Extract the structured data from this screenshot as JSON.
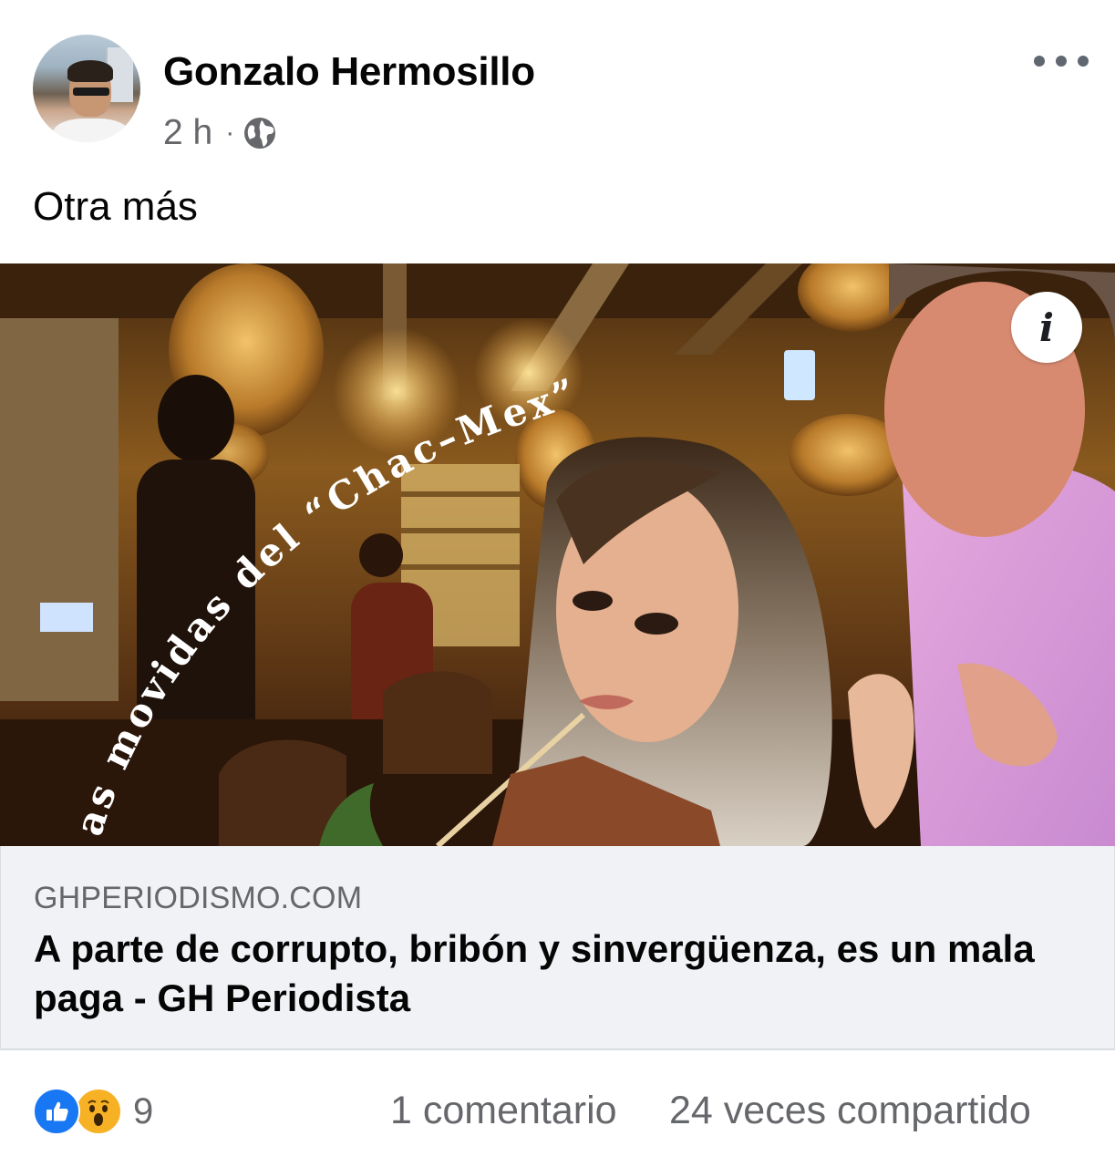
{
  "post": {
    "author": "Gonzalo Hermosillo",
    "time": "2 h",
    "separator": "·",
    "privacy_icon": "globe-icon",
    "text": "Otra más",
    "more_icon": "more-options-icon"
  },
  "link_preview": {
    "image_overlay_text": "as movidas del “Chac–Mex”",
    "info_glyph": "i",
    "domain": "GHPERIODISMO.COM",
    "title": "A parte de corrupto, bribón y sinvergüenza, es un mala paga - GH Periodista"
  },
  "footer": {
    "reaction_count": "9",
    "comments": "1 comentario",
    "shares": "24 veces compartido"
  },
  "colors": {
    "accent": "#1877f2",
    "secondary_text": "#65676b",
    "link_background": "#f0f2f5",
    "wow": "#f7b125"
  }
}
